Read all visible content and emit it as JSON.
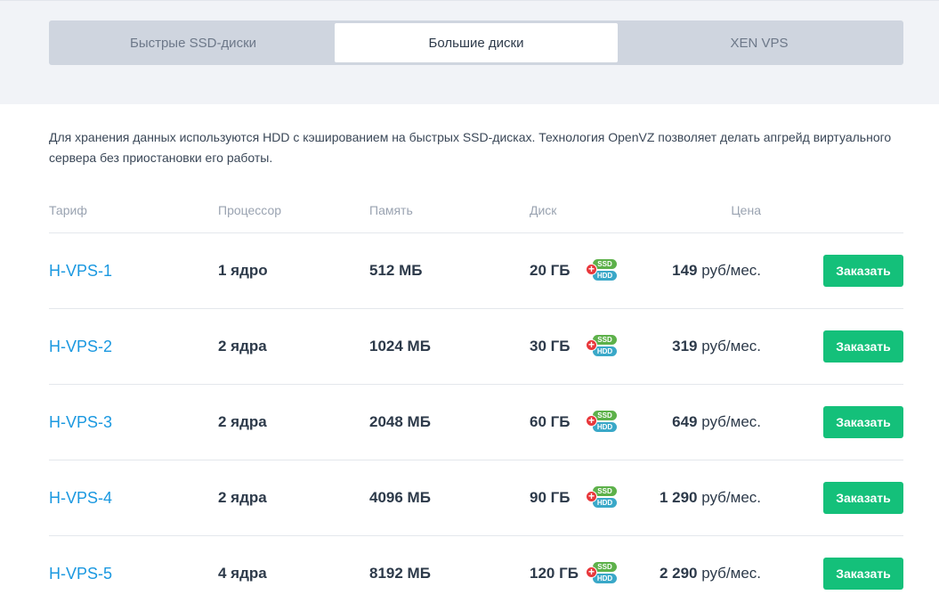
{
  "tabs": [
    {
      "label": "Быстрые SSD-диски",
      "active": false
    },
    {
      "label": "Большие диски",
      "active": true
    },
    {
      "label": "XEN VPS",
      "active": false
    }
  ],
  "description": "Для хранения данных используются HDD с кэшированием на быстрых SSD-дисках. Технология OpenVZ позволяет делать апгрейд виртуального сервера без приостановки его работы.",
  "columns": {
    "name": "Тариф",
    "cpu": "Процессор",
    "memory": "Память",
    "disk": "Диск",
    "price": "Цена"
  },
  "badge": {
    "ssd": "SSD",
    "hdd": "HDD",
    "plus": "+"
  },
  "price_unit": "руб/мес.",
  "order_label": "Заказать",
  "plans": [
    {
      "name": "H-VPS-1",
      "cpu": "1 ядро",
      "memory": "512 МБ",
      "disk": "20 ГБ",
      "price": "149"
    },
    {
      "name": "H-VPS-2",
      "cpu": "2 ядра",
      "memory": "1024 МБ",
      "disk": "30 ГБ",
      "price": "319"
    },
    {
      "name": "H-VPS-3",
      "cpu": "2 ядра",
      "memory": "2048 МБ",
      "disk": "60 ГБ",
      "price": "649"
    },
    {
      "name": "H-VPS-4",
      "cpu": "2 ядра",
      "memory": "4096 МБ",
      "disk": "90 ГБ",
      "price": "1 290"
    },
    {
      "name": "H-VPS-5",
      "cpu": "4 ядра",
      "memory": "8192 МБ",
      "disk": "120 ГБ",
      "price": "2 290"
    }
  ],
  "colors": {
    "link": "#1a98e0",
    "button": "#14c07a",
    "badge_ssd": "#5db14a",
    "badge_hdd": "#3aa8c8",
    "badge_plus": "#e8373b"
  }
}
